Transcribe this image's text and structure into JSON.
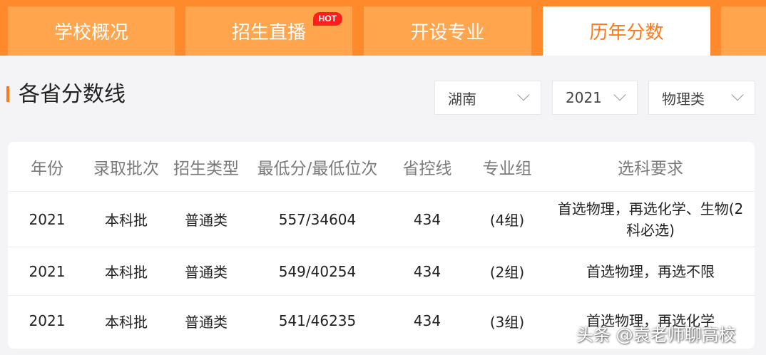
{
  "tabs": [
    {
      "label": "学校概况",
      "active": false
    },
    {
      "label": "招生直播",
      "active": false,
      "badge": "HOT"
    },
    {
      "label": "开设专业",
      "active": false
    },
    {
      "label": "历年分数",
      "active": true
    }
  ],
  "section_title": "各省分数线",
  "filters": {
    "province": "湖南",
    "year": "2021",
    "subject_type": "物理类"
  },
  "table": {
    "headers": [
      "年份",
      "录取批次",
      "招生类型",
      "最低分/最低位次",
      "省控线",
      "专业组",
      "选科要求"
    ],
    "rows": [
      {
        "year": "2021",
        "batch": "本科批",
        "type": "普通类",
        "min_score_rank": "557/34604",
        "control_line": "434",
        "group": "(4组)",
        "requirement": "首选物理，再选化学、生物(2科必选)"
      },
      {
        "year": "2021",
        "batch": "本科批",
        "type": "普通类",
        "min_score_rank": "549/40254",
        "control_line": "434",
        "group": "(2组)",
        "requirement": "首选物理，再选不限"
      },
      {
        "year": "2021",
        "batch": "本科批",
        "type": "普通类",
        "min_score_rank": "541/46235",
        "control_line": "434",
        "group": "(3组)",
        "requirement": "首选物理，再选化学"
      }
    ]
  },
  "watermark": "头条 @袁老师聊高校",
  "colors": {
    "tab_bar": "#ff8a2b",
    "tab": "#ffa54d",
    "accent": "#ff7a1a",
    "hot_badge": "#ff1e1e"
  }
}
